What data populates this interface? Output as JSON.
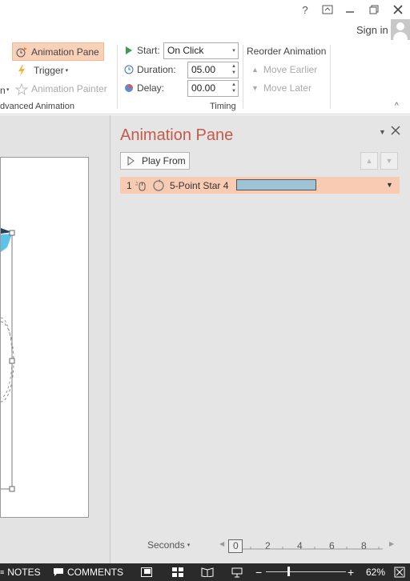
{
  "window": {
    "help": "?",
    "sign_in": "Sign in"
  },
  "ribbon": {
    "preview_fragment": "n",
    "animation_pane": "Animation Pane",
    "trigger": "Trigger",
    "animation_painter": "Animation Painter",
    "advanced_group": "dvanced Animation",
    "start_label": "Start:",
    "start_value": "On Click",
    "duration_label": "Duration:",
    "duration_value": "05.00",
    "delay_label": "Delay:",
    "delay_value": "00.00",
    "timing_group": "Timing",
    "reorder_title": "Reorder Animation",
    "move_earlier": "Move Earlier",
    "move_later": "Move Later"
  },
  "pane": {
    "title": "Animation Pane",
    "play_from": "Play From",
    "items": [
      {
        "number": "1",
        "name": "5-Point Star 4"
      }
    ],
    "timeline": {
      "seconds_label": "Seconds",
      "ticks": [
        "0",
        "2",
        "4",
        "6",
        "8"
      ]
    }
  },
  "status": {
    "notes": "NOTES",
    "comments": "COMMENTS",
    "zoom": "62%"
  },
  "colors": {
    "accent": "#c55a48",
    "selection": "#f9cbb3",
    "bar": "#9fc3d6",
    "status_bg": "#2a2a2a"
  }
}
